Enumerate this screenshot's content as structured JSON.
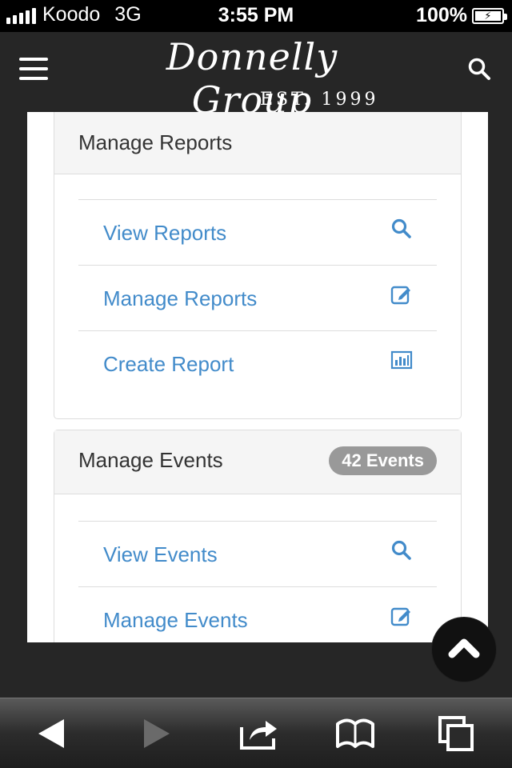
{
  "status_bar": {
    "carrier": "Koodo",
    "network": "3G",
    "time": "3:55 PM",
    "battery": "100%",
    "battery_level": 1.0
  },
  "header": {
    "logo_script": "Donnelly Group",
    "logo_est": "EST. 1999",
    "menu_icon": "hamburger-icon",
    "search_icon": "search-icon"
  },
  "reports_panel": {
    "title": "Manage Reports",
    "items": [
      {
        "label": "View Reports",
        "icon": "search-icon"
      },
      {
        "label": "Manage Reports",
        "icon": "edit-icon"
      },
      {
        "label": "Create Report",
        "icon": "bar-chart-icon"
      }
    ]
  },
  "events_panel": {
    "title": "Manage Events",
    "badge": "42 Events",
    "items": [
      {
        "label": "View Events",
        "icon": "search-icon"
      },
      {
        "label": "Manage Events",
        "icon": "edit-icon"
      }
    ]
  },
  "scroll_top_icon": "chevron-up-icon",
  "browser_toolbar": {
    "icons": [
      "back-arrow-icon",
      "forward-arrow-icon",
      "share-icon",
      "bookmarks-icon",
      "tabs-icon"
    ]
  },
  "colors": {
    "link": "#428bca",
    "badge": "#999999",
    "panel_heading_bg": "#f5f5f5",
    "page_bg": "#262626"
  }
}
